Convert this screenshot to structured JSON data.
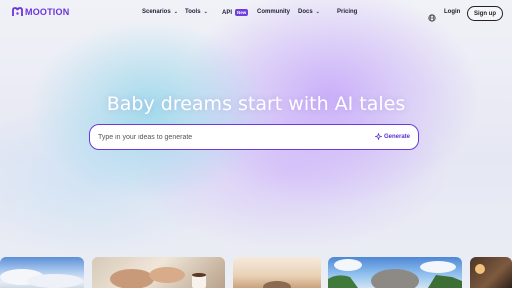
{
  "brand": {
    "name": "MOOTION",
    "color": "#6a35d9"
  },
  "nav": {
    "items": [
      {
        "label": "Scenarios",
        "dropdown": true
      },
      {
        "label": "Tools",
        "dropdown": true
      },
      {
        "label": "API",
        "badge": "New"
      },
      {
        "label": "Community"
      },
      {
        "label": "Docs",
        "dropdown": true
      },
      {
        "label": "Pricing"
      }
    ],
    "language_icon": "globe-icon",
    "login_label": "Login",
    "signup_label": "Sign up"
  },
  "hero": {
    "title": "Baby dreams start with AI tales",
    "input_placeholder": "Type in your ideas to generate",
    "input_value": "",
    "generate_label": "Generate",
    "generate_icon": "sparkle-icon",
    "accent": "#6a3bdc"
  },
  "gallery": {
    "thumbnails": [
      {
        "subject": "sky-clouds"
      },
      {
        "subject": "hands-coffee"
      },
      {
        "subject": "warm-room"
      },
      {
        "subject": "elephant-landscape"
      },
      {
        "subject": "lamp-interior"
      }
    ]
  }
}
